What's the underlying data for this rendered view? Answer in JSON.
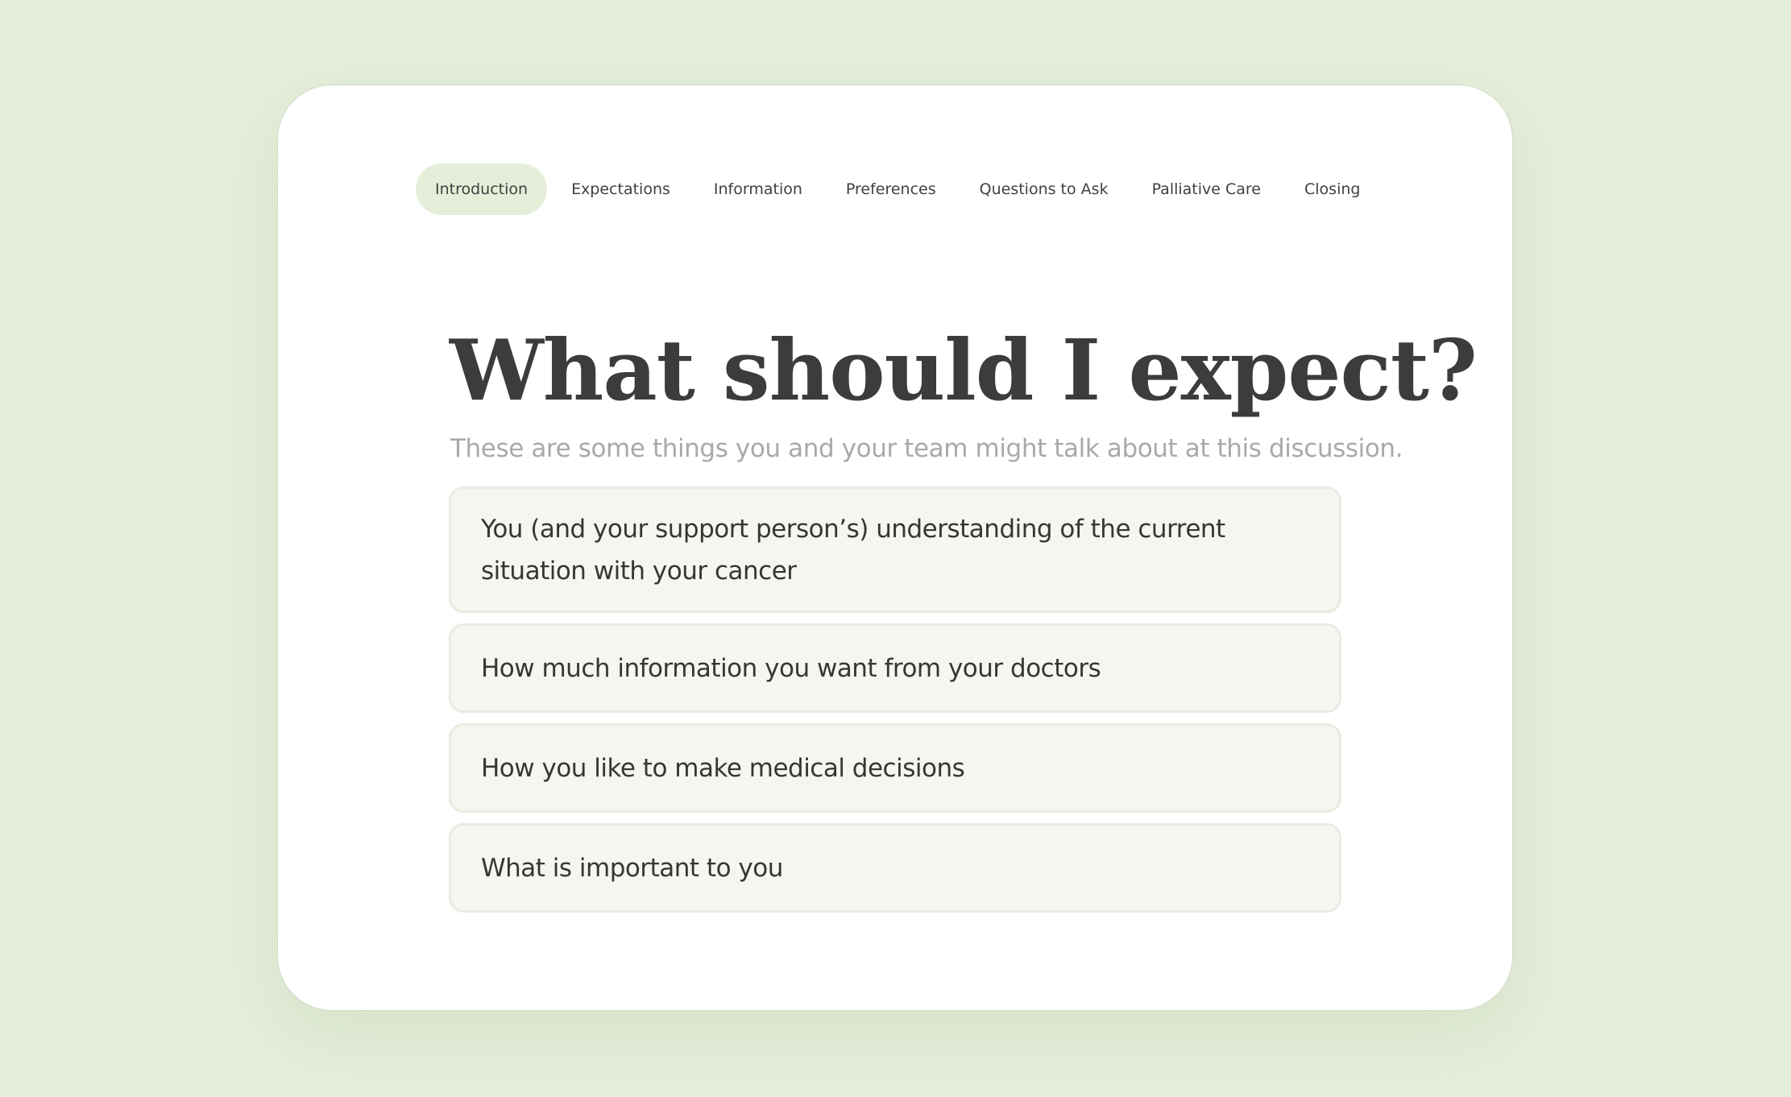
{
  "nav": {
    "tabs": [
      {
        "label": "Introduction",
        "active": true
      },
      {
        "label": "Expectations",
        "active": false
      },
      {
        "label": "Information",
        "active": false
      },
      {
        "label": "Preferences",
        "active": false
      },
      {
        "label": "Questions to Ask",
        "active": false
      },
      {
        "label": "Palliative Care",
        "active": false
      },
      {
        "label": "Closing",
        "active": false
      }
    ]
  },
  "main": {
    "title": "What should I expect?",
    "subtitle": "These are some things you and your team might talk about at this discussion.",
    "items": [
      {
        "text": "You (and your support person’s) understanding of the current situation with your cancer"
      },
      {
        "text": "How much information you want from your doctors"
      },
      {
        "text": "How you like to make medical decisions"
      },
      {
        "text": "What is important to you"
      }
    ]
  },
  "colors": {
    "background": "#e4eed9",
    "card": "#ffffff",
    "active_tab": "#e4eed9",
    "item_fill": "#f4f7ef",
    "item_border": "#e8ece3",
    "title_text": "#3c3c3c",
    "subtitle_text": "#a8aaa6"
  }
}
